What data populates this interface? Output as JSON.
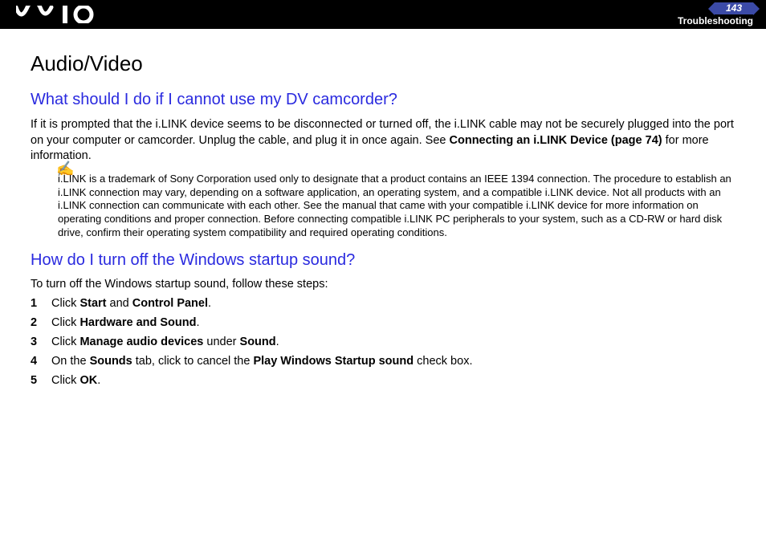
{
  "header": {
    "page_number": "143",
    "section": "Troubleshooting"
  },
  "content": {
    "title": "Audio/Video",
    "q1": {
      "heading": "What should I do if I cannot use my DV camcorder?",
      "para_a": "If it is prompted that the i.LINK device seems to be disconnected or turned off, the i.LINK cable may not be securely plugged into the port on your computer or camcorder. Unplug the cable, and plug it in once again. See ",
      "link": "Connecting an i.LINK Device (page 74)",
      "para_b": " for more information.",
      "note_icon": "✍",
      "note": "i.LINK is a trademark of Sony Corporation used only to designate that a product contains an IEEE 1394 connection. The procedure to establish an i.LINK connection may vary, depending on a software application, an operating system, and a compatible i.LINK device. Not all products with an i.LINK connection can communicate with each other. See the manual that came with your compatible i.LINK device for more information on operating conditions and proper connection. Before connecting compatible i.LINK PC peripherals to your system, such as a CD-RW or hard disk drive, confirm their operating system compatibility and required operating conditions."
    },
    "q2": {
      "heading": "How do I turn off the Windows startup sound?",
      "intro": "To turn off the Windows startup sound, follow these steps:",
      "steps": [
        {
          "n": "1",
          "pre": "Click ",
          "b1": "Start",
          "mid": " and ",
          "b2": "Control Panel",
          "post": "."
        },
        {
          "n": "2",
          "pre": "Click ",
          "b1": "Hardware and Sound",
          "mid": "",
          "b2": "",
          "post": "."
        },
        {
          "n": "3",
          "pre": "Click ",
          "b1": "Manage audio devices",
          "mid": " under ",
          "b2": "Sound",
          "post": "."
        },
        {
          "n": "4",
          "pre": "On the ",
          "b1": "Sounds",
          "mid": " tab, click to cancel the ",
          "b2": "Play Windows Startup sound",
          "post": " check box."
        },
        {
          "n": "5",
          "pre": "Click ",
          "b1": "OK",
          "mid": "",
          "b2": "",
          "post": "."
        }
      ]
    }
  }
}
